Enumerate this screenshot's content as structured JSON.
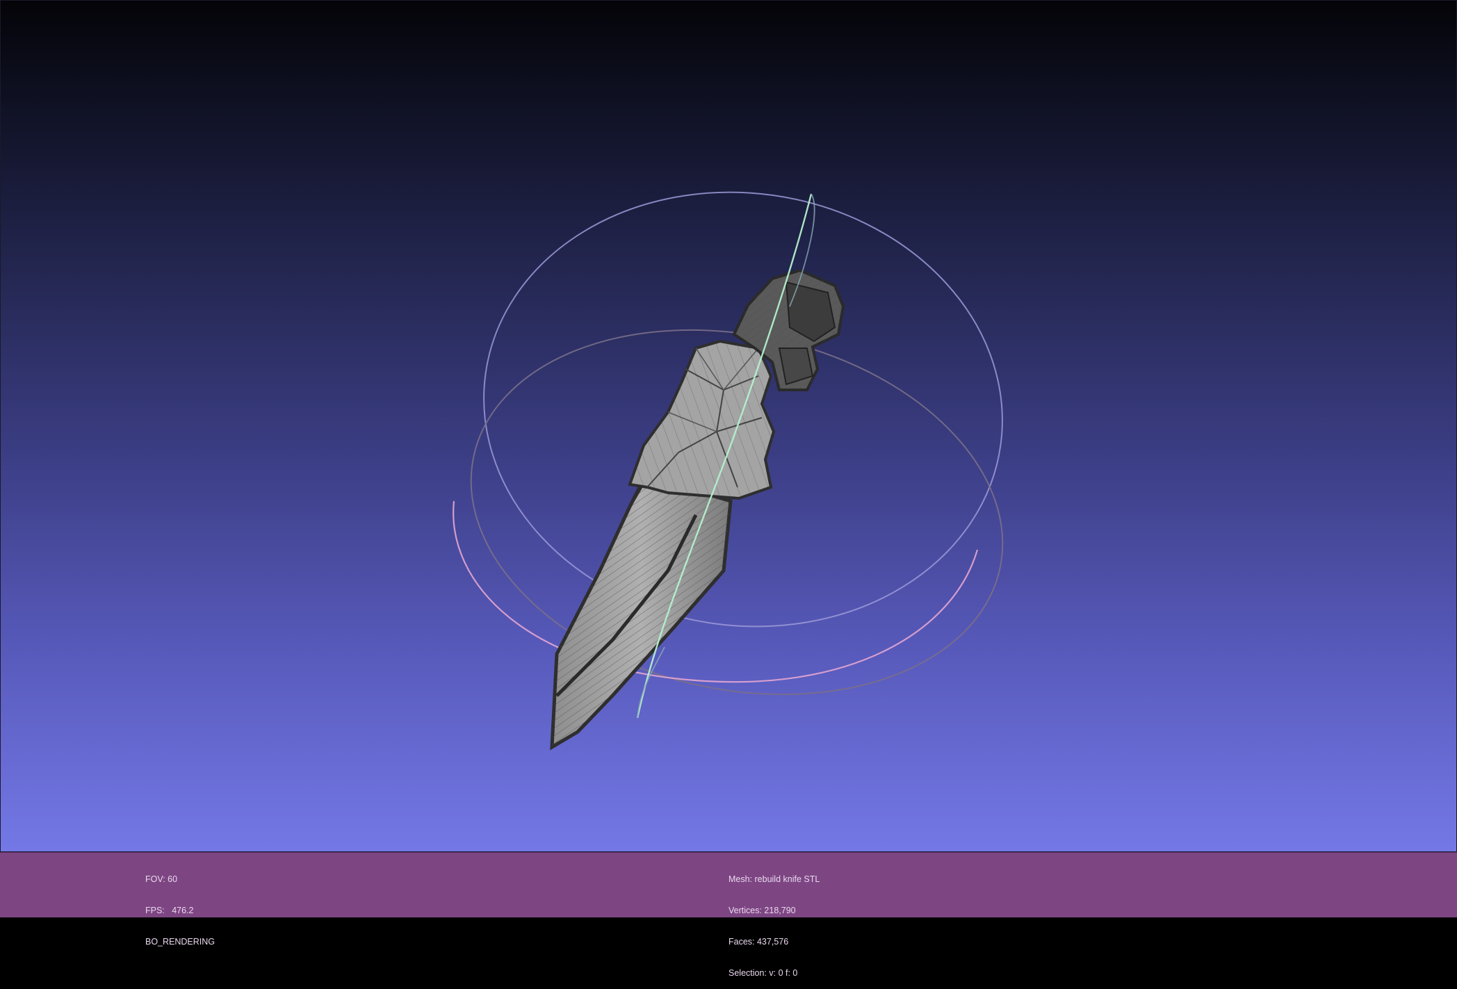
{
  "viewer": {
    "background_top": "#040408",
    "background_bottom": "#7478e6",
    "mesh_color": "#9a9a9a",
    "wire_color": "#3a3a3a"
  },
  "trackball": {
    "ring_horizontal_color": "#e8a8d8",
    "ring_vertical_color": "#b8f0d0",
    "ring_top_color": "#c8c8ff"
  },
  "status_bar": {
    "color": "#7d4683",
    "left": {
      "fov": "FOV: 60",
      "fps": "FPS:   476.2",
      "mode": "BO_RENDERING"
    },
    "right": {
      "mesh": "Mesh: rebuild knife STL",
      "vertices": "Vertices: 218,790",
      "faces": "Faces: 437,576",
      "selection": "Selection: v: 0 f: 0"
    }
  }
}
